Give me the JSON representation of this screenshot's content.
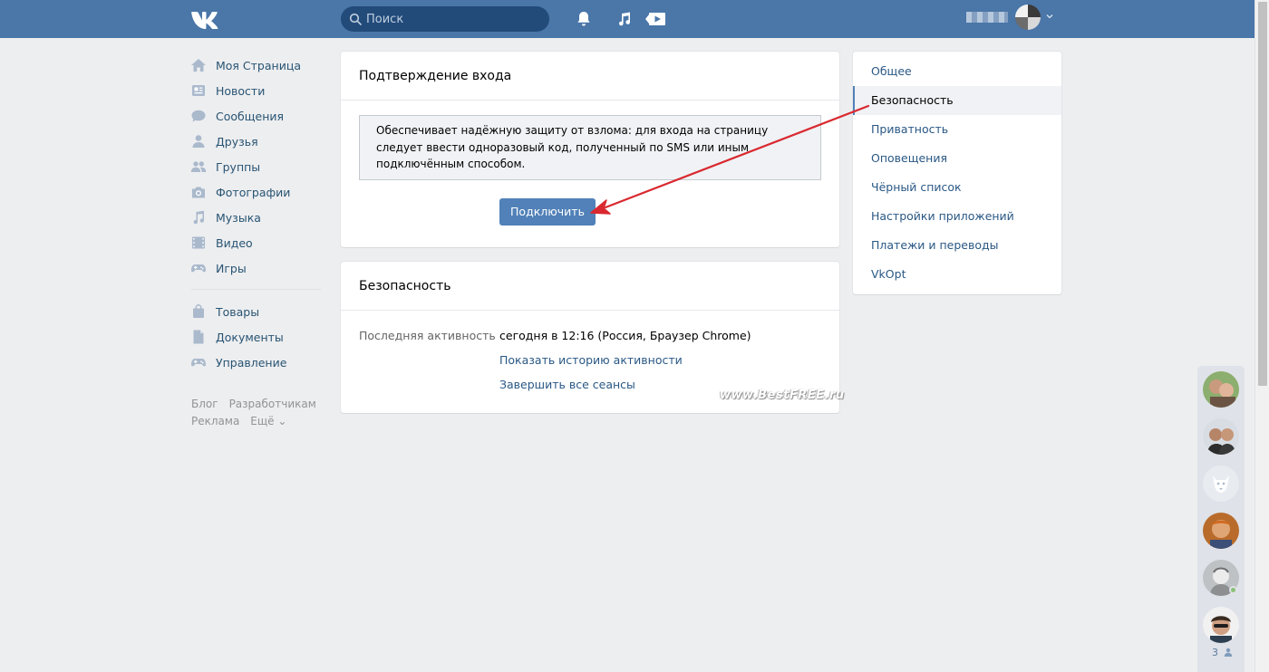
{
  "header": {
    "search_placeholder": "Поиск"
  },
  "leftnav": {
    "items": [
      {
        "label": "Моя Страница",
        "icon": "home-icon"
      },
      {
        "label": "Новости",
        "icon": "news-icon"
      },
      {
        "label": "Сообщения",
        "icon": "messages-icon"
      },
      {
        "label": "Друзья",
        "icon": "friends-icon"
      },
      {
        "label": "Группы",
        "icon": "groups-icon"
      },
      {
        "label": "Фотографии",
        "icon": "camera-icon"
      },
      {
        "label": "Музыка",
        "icon": "music-icon"
      },
      {
        "label": "Видео",
        "icon": "video-icon"
      },
      {
        "label": "Игры",
        "icon": "gamepad-icon"
      }
    ],
    "items2": [
      {
        "label": "Товары",
        "icon": "bag-icon"
      },
      {
        "label": "Документы",
        "icon": "document-icon"
      },
      {
        "label": "Управление",
        "icon": "gamepad-icon"
      }
    ],
    "footer": {
      "blog": "Блог",
      "developers": "Разработчикам",
      "ads": "Реклама",
      "more": "Ещё ⌄"
    }
  },
  "login_confirm": {
    "title": "Подтверждение входа",
    "info": "Обеспечивает надёжную защиту от взлома: для входа на страницу следует ввести одноразовый код, полученный по SMS или иным подключённым способом.",
    "button": "Подключить"
  },
  "security": {
    "title": "Безопасность",
    "last_activity_label": "Последняя активность",
    "last_activity_value": "сегодня в 12:16 (Россия, Браузер Chrome)",
    "show_history": "Показать историю активности",
    "end_sessions": "Завершить все сеансы",
    "watermark": "www.BestFREE.ru"
  },
  "settings_menu": {
    "items": [
      {
        "label": "Общее",
        "active": false
      },
      {
        "label": "Безопасность",
        "active": true
      },
      {
        "label": "Приватность",
        "active": false
      },
      {
        "label": "Оповещения",
        "active": false
      },
      {
        "label": "Чёрный список",
        "active": false
      },
      {
        "label": "Настройки приложений",
        "active": false
      },
      {
        "label": "Платежи и переводы",
        "active": false
      },
      {
        "label": "VkOpt",
        "active": false
      }
    ]
  },
  "friends_dock": {
    "count": "3"
  },
  "colors": {
    "header": "#4a76a8",
    "link": "#2a5885",
    "button": "#5181b8",
    "arrow": "#d9282f"
  }
}
